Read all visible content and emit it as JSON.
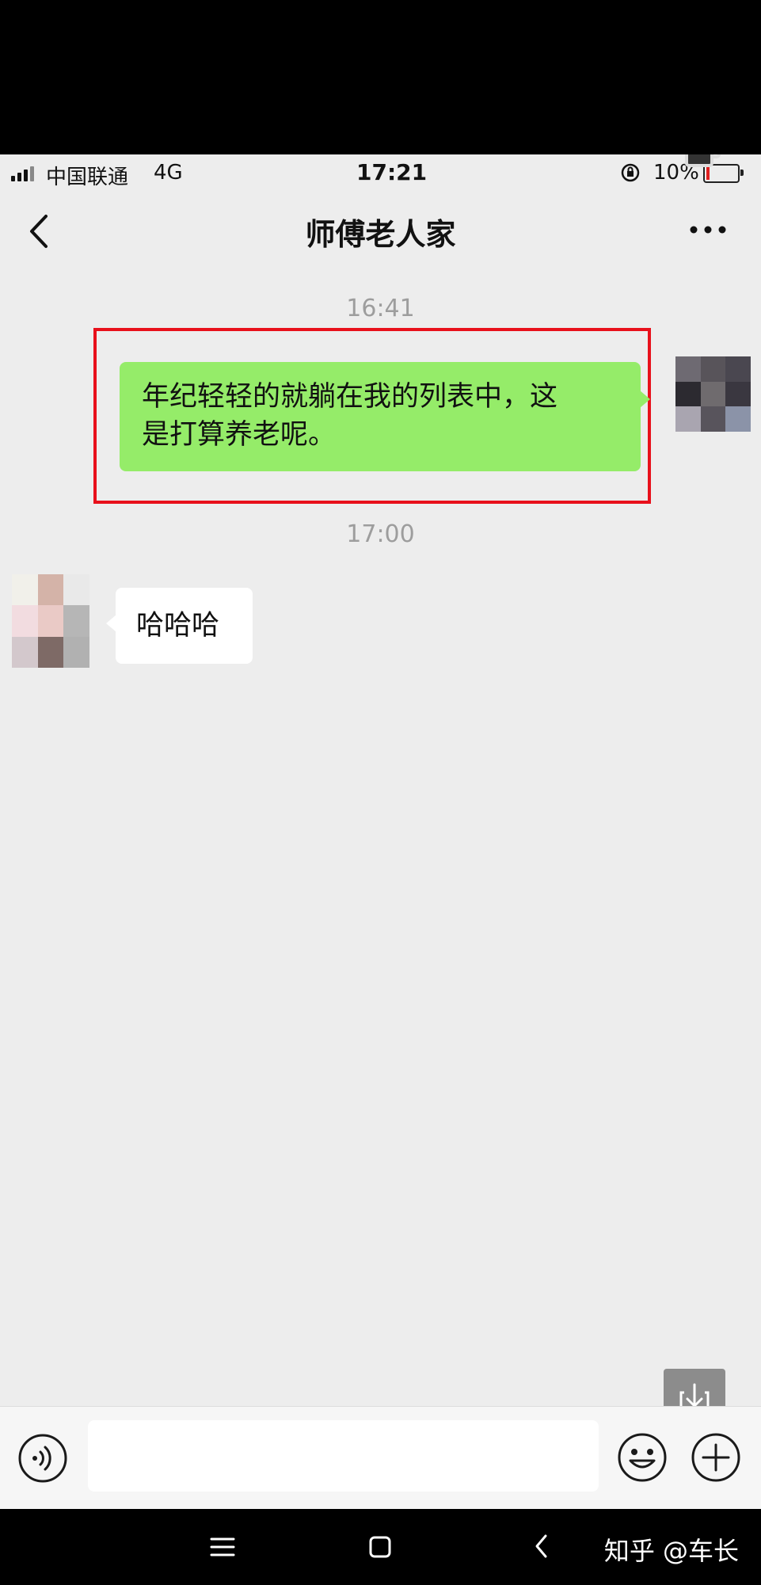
{
  "status_bar": {
    "carrier": "中国联通",
    "network": "4G",
    "time": "17:21",
    "battery": "10%",
    "battery_level": 0.1,
    "battery_low_color": "#e02020"
  },
  "nav": {
    "title": "师傅老人家",
    "back_icon": "chevron-left-icon",
    "more_icon": "more-dots-icon"
  },
  "messages": [
    {
      "time": "16:41",
      "direction": "outgoing",
      "text_line1": "年纪轻轻的就躺在我的列表中，这",
      "text_line2": "是打算养老呢。",
      "highlighted": true,
      "highlight_color": "#e8101b"
    },
    {
      "time": "17:00",
      "direction": "incoming",
      "text": "哈哈哈"
    }
  ],
  "colors": {
    "outgoing_bubble": "#95ec69",
    "incoming_bubble": "#ffffff",
    "chat_background": "#ededed"
  },
  "input_bar": {
    "voice_icon": "voice-icon",
    "emoji_icon": "emoji-icon",
    "plus_icon": "plus-icon",
    "input_value": ""
  },
  "floating": {
    "save_icon": "save-download-icon"
  },
  "android_nav": {
    "menu_icon": "menu-icon",
    "home_icon": "home-icon",
    "back_icon": "back-icon"
  },
  "watermark": "知乎 @车长"
}
